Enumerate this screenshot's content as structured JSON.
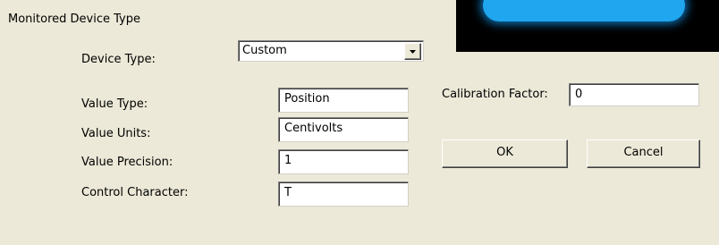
{
  "group": {
    "title": "Monitored Device Type"
  },
  "device_type": {
    "label": "Device Type:",
    "value": "Custom",
    "arrow_icon": "chevron-down-icon"
  },
  "fields": {
    "value_type": {
      "label": "Value Type:",
      "value": "Position"
    },
    "value_units": {
      "label": "Value Units:",
      "value": "Centivolts"
    },
    "value_precision": {
      "label": "Value Precision:",
      "value": "1"
    },
    "control_character": {
      "label": "Control Character:",
      "value": "T"
    }
  },
  "calibration": {
    "label": "Calibration Factor:",
    "value": "0"
  },
  "buttons": {
    "ok": "OK",
    "cancel": "Cancel"
  },
  "colors": {
    "background": "#ece9d8",
    "preview_glow": "#1fa6ef",
    "preview_bg": "#000000"
  }
}
